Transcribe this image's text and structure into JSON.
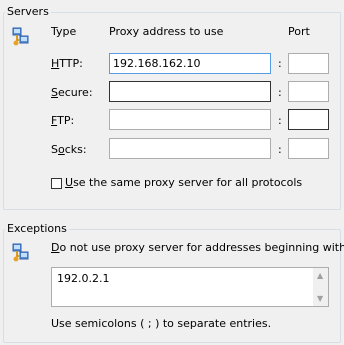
{
  "servers": {
    "title": "Servers",
    "col_type": "Type",
    "col_address": "Proxy address to use",
    "col_port": "Port",
    "rows": [
      {
        "label": "HTTP:",
        "mnemonic": "H",
        "rest": "TTP:",
        "address": "192.168.162.10",
        "port": ""
      },
      {
        "label": "Secure:",
        "mnemonic": "S",
        "rest": "ecure:",
        "address": "",
        "port": ""
      },
      {
        "label": "FTP:",
        "mnemonic": "F",
        "rest": "TP:",
        "address": "",
        "port": ""
      },
      {
        "label": "Socks:",
        "mnemonic": "o",
        "pre": "S",
        "rest": "cks:",
        "address": "",
        "port": ""
      }
    ],
    "same_proxy_label": "Use the same proxy server for all protocols",
    "same_proxy_mnemonic": "U",
    "same_proxy_rest": "se the same proxy server for all protocols",
    "same_proxy_checked": false
  },
  "exceptions": {
    "title": "Exceptions",
    "description_mnemonic": "D",
    "description_rest": "o not use proxy server for addresses beginning with:",
    "value": "192.0.2.1",
    "hint": "Use semicolons ( ; ) to separate entries."
  },
  "icons": [
    "servers-network-icon",
    "exceptions-network-icon"
  ]
}
